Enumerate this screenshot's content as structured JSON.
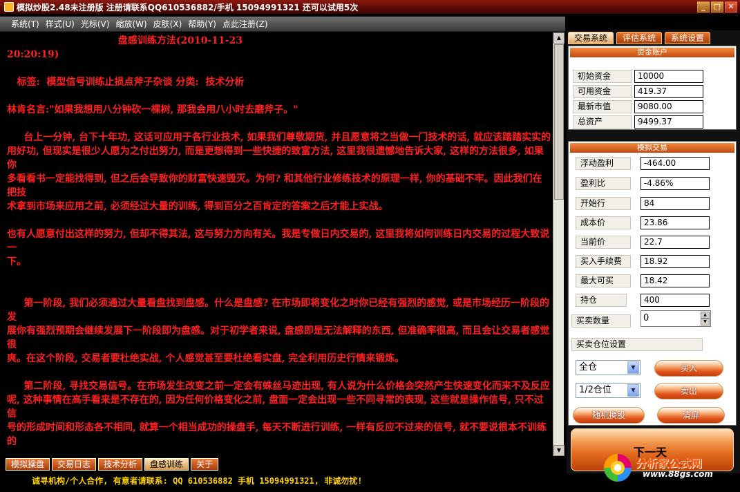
{
  "window": {
    "title": "模拟炒股2.48未注册版 注册请联系QQ610536882/手机 15094991321 还可以试用5次"
  },
  "menu": [
    "系统(T)",
    "样式(U)",
    "光标(V)",
    "缩放(W)",
    "皮肤(X)",
    "帮助(Y)",
    "点此注册(Z)"
  ],
  "article": {
    "text": "                                 盘感训练方法(2010-11-23\n20:20:19)\n\n   标签:  模型信号训练止损点斧子杂谈 分类:  技术分析\n\n林肯名言:\"如果我想用八分钟砍一棵树, 那我会用八小时去磨斧子。\"\n\n     台上一分钟, 台下十年功, 这话可应用于各行业技术, 如果我们尊敬期货, 并且愿意将之当做一门技术的话, 就应该踏踏实实的\n用好功, 但现实是很少人愿为之付出努力, 而是更想得到一些快捷的致富方法, 这里我很遗憾地告诉大家, 这样的方法很多, 如果你\n多看看书一定能找得到, 但之后会导致你的财富快速毁灭。为何? 和其他行业修练技术的原理一样, 你的基础不牢。因此我们在把技\n术拿到市场来应用之前, 必须经过大量的训练, 得到百分之百肯定的答案之后才能上实战。\n\n也有人愿意付出这样的努力, 但却不得其法, 这与努力方向有关。我是专做日内交易的, 这里我将如何训练日内交易的过程大致说一\n下。\n\n\n     第一阶段, 我们必须通过大量看盘找到盘感。什么是盘感? 在市场即将变化之时你已经有强烈的感觉, 或是市场经历一阶段的发\n展你有强烈预期会继续发展下一阶段即为盘感。对于初学者来说, 盘感即是无法解释的东西, 但准确率很高, 而且会让交易者感觉很\n爽。在这个阶段, 交易者要杜绝实战, 个人感觉甚至要杜绝看实盘, 完全利用历史行情来锻炼。\n\n     第二阶段, 寻找交易信号。在市场发生改变之前一定会有蛛丝马迹出现, 有人说为什么价格会突然产生快速变化而来不及反应\n呢, 这种事情在高手看来是不存在的, 因为任何价格变化之前, 盘面一定会出现一些不同寻常的表现, 这些就是操作信号, 只不过信\n号的形成时间和形态各不相同, 就算一个相当成功的操盘手, 每天不断进行训练, 一样有反应不过来的信号, 就不要说根本不训练的"
  },
  "bottom_tabs": [
    "模拟操盘",
    "交易日志",
    "技术分析",
    "盘感训练",
    "关于"
  ],
  "bottom_tab_active": "盘感训练",
  "status": {
    "message": "诚寻机构/个人合作, 有意者请联系: QQ 610536882 手机 15094991321, 非诚勿扰!"
  },
  "right_tabs": [
    "交易系统",
    "评估系统",
    "系统设置"
  ],
  "right_tab_active": "交易系统",
  "account": {
    "header": "资金账户",
    "rows": [
      {
        "label": "初始资金",
        "value": "10000"
      },
      {
        "label": "可用资金",
        "value": "419.37"
      },
      {
        "label": "最新市值",
        "value": "9080.00"
      },
      {
        "label": "总资产",
        "value": "9499.37"
      }
    ]
  },
  "trade": {
    "header": "模拟交易",
    "rows": [
      {
        "label": "浮动盈利",
        "value": "-464.00"
      },
      {
        "label": "盈利比",
        "value": "-4.86%"
      },
      {
        "label": "开始行",
        "value": "84"
      },
      {
        "label": "成本价",
        "value": "23.86"
      },
      {
        "label": "当前价",
        "value": "22.7"
      },
      {
        "label": "买入手续费",
        "value": "18.92"
      },
      {
        "label": "最大可买",
        "value": "18.42"
      },
      {
        "label": "持仓",
        "value": "400"
      }
    ],
    "qty_label": "买卖数量",
    "qty_value": "0",
    "position_label": "买卖仓位设置",
    "combo1": "全仓",
    "combo2": "1/2仓位",
    "buy": "买入",
    "sell": "卖出",
    "random": "随机换股",
    "clear": "清屏",
    "next_day": "下一天"
  },
  "watermark": {
    "brand": "分析家公式网",
    "url": "www.88gs.com"
  }
}
